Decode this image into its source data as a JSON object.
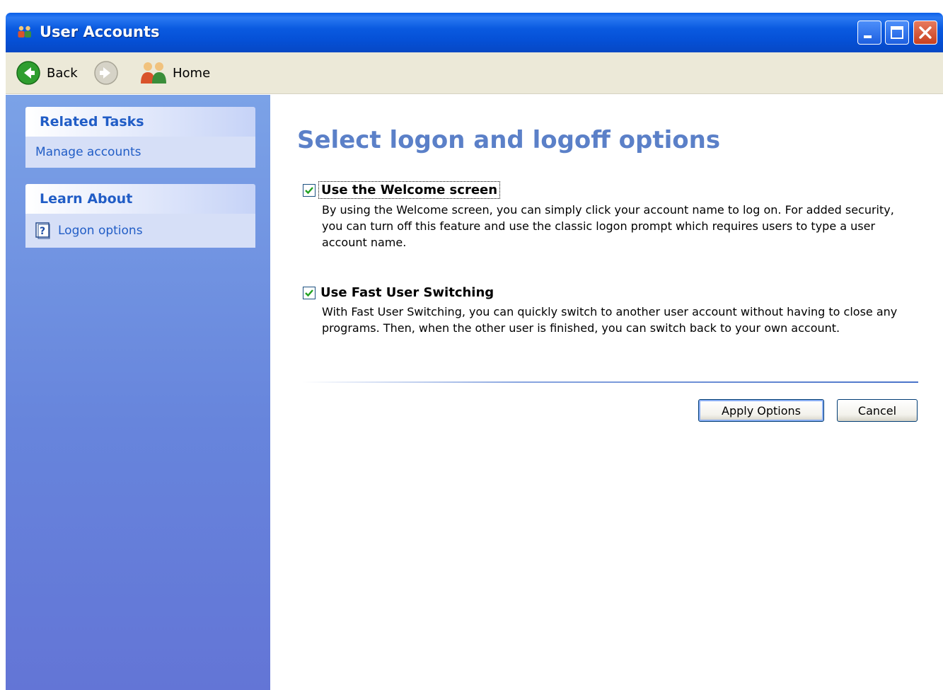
{
  "window": {
    "title": "User Accounts",
    "caption_buttons": [
      "minimize-icon",
      "maximize-icon",
      "close-icon"
    ]
  },
  "toolbar": {
    "back_label": "Back",
    "home_label": "Home"
  },
  "sidebar": {
    "related_tasks": {
      "header": "Related Tasks",
      "links": [
        "Manage accounts"
      ]
    },
    "learn_about": {
      "header": "Learn About",
      "links": [
        "Logon options"
      ]
    }
  },
  "main": {
    "title": "Select logon and logoff options",
    "options": [
      {
        "label": "Use the Welcome screen",
        "checked": true,
        "description": "By using the Welcome screen, you can simply click your account name to log on. For added security, you can turn off this feature and use the classic logon prompt which requires users to type a user account name."
      },
      {
        "label": "Use Fast User Switching",
        "checked": true,
        "description": "With Fast User Switching, you can quickly switch to another user account without having to close any programs. Then, when the other user is finished, you can switch back to your own account."
      }
    ],
    "buttons": {
      "apply": "Apply Options",
      "cancel": "Cancel"
    }
  },
  "colors": {
    "titlebar": "#0a5ae0",
    "sidebar": "#6b88dc",
    "link": "#215dc6",
    "heading": "#5b80c8"
  }
}
